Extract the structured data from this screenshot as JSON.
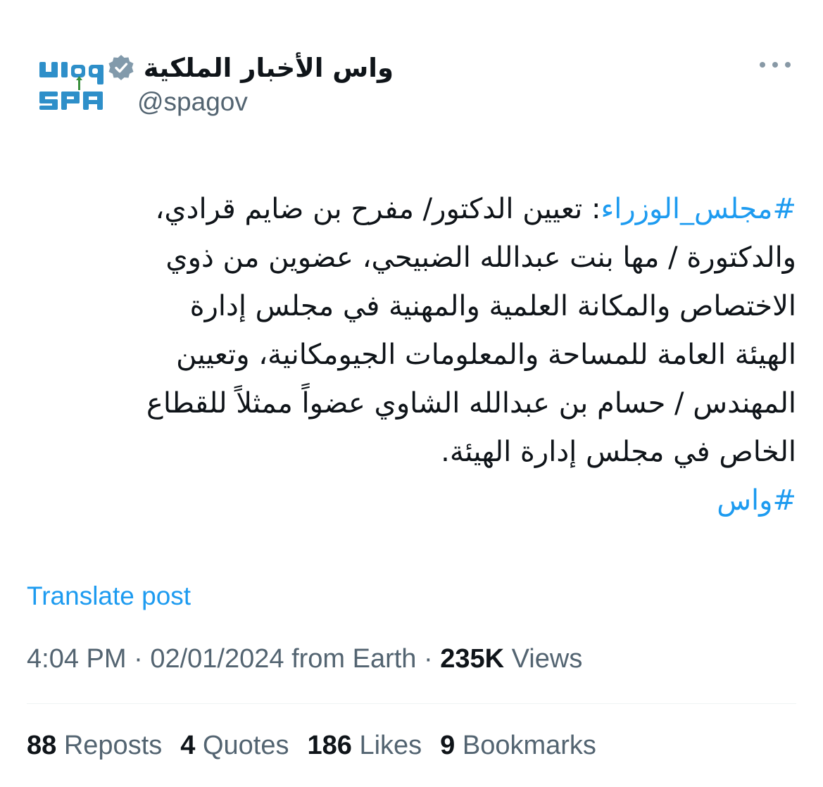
{
  "author": {
    "name": "واس الأخبار الملكية",
    "handle": "@spagov",
    "avatar_logo_text": "SPA",
    "verified_icon": "verified-badge-icon"
  },
  "more_icon": "more-horizontal-icon",
  "post": {
    "hashtag_1": "#مجلس_الوزراء",
    "line_1_rest": ": تعيين الدكتور/ مفرح بن ضايم قرادي،",
    "line_2": "والدكتورة / مها بنت عبدالله الضبيحي، عضوين من ذوي",
    "line_3": "الاختصاص والمكانة العلمية والمهنية في مجلس إدارة",
    "line_4": "الهيئة العامة للمساحة والمعلومات الجيومكانية، وتعيين",
    "line_5": "المهندس / حسام بن عبدالله الشاوي عضواً ممثلاً للقطاع",
    "line_6": "الخاص في مجلس إدارة الهيئة.",
    "hashtag_2": "#واس"
  },
  "translate_label": "Translate post",
  "meta": {
    "time": "4:04 PM",
    "separator": "·",
    "date": "02/01/2024",
    "location": "from Earth",
    "views_count": "235K",
    "views_label": "Views"
  },
  "stats": {
    "reposts_count": "88",
    "reposts_label": "Reposts",
    "quotes_count": "4",
    "quotes_label": "Quotes",
    "likes_count": "186",
    "likes_label": "Likes",
    "bookmarks_count": "9",
    "bookmarks_label": "Bookmarks"
  },
  "colors": {
    "accent": "#1d9bf0",
    "text_primary": "#0f1419",
    "text_secondary": "#536471",
    "logo_blue": "#2e8fc9",
    "logo_green": "#3a8f3c"
  }
}
